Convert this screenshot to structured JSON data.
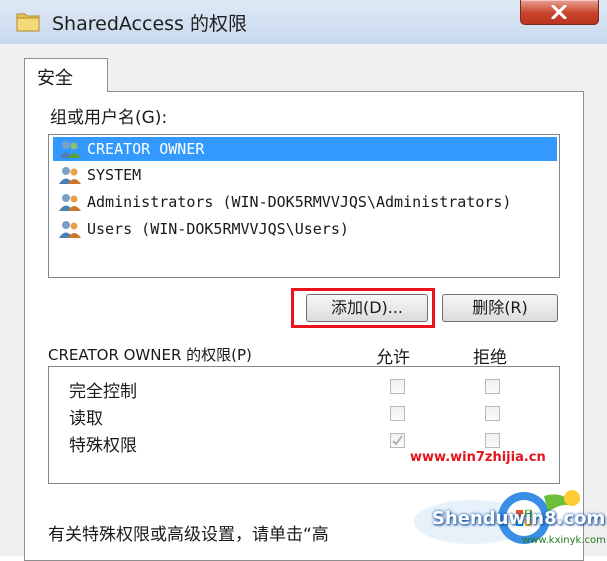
{
  "window": {
    "title": "SharedAccess 的权限",
    "close_icon": "close-icon"
  },
  "tabs": [
    {
      "label": "安全"
    }
  ],
  "groups_label": "组或用户名(G):",
  "users": [
    {
      "label": "CREATOR OWNER",
      "selected": true
    },
    {
      "label": "SYSTEM",
      "selected": false
    },
    {
      "label": "Administrators (WIN-DOK5RMVVJQS\\Administrators)",
      "selected": false
    },
    {
      "label": "Users (WIN-DOK5RMVVJQS\\Users)",
      "selected": false
    }
  ],
  "buttons": {
    "add": "添加(D)...",
    "remove": "删除(R)"
  },
  "permissions": {
    "label": "CREATOR OWNER 的权限(P)",
    "allow_header": "允许",
    "deny_header": "拒绝",
    "rows": [
      {
        "name": "完全控制",
        "allow": false,
        "deny": false
      },
      {
        "name": "读取",
        "allow": false,
        "deny": false
      },
      {
        "name": "特殊权限",
        "allow": true,
        "deny": false
      }
    ]
  },
  "bottom_text": "有关特殊权限或高级设置，请单击“高",
  "watermark": {
    "site1": "www.win7zhijia.cn",
    "brand": "Shenduwin8.com",
    "site2": "www.kxinyk.com"
  },
  "colors": {
    "selection": "#3399ff",
    "highlight": "#e8141c",
    "close": "#c9442c"
  }
}
